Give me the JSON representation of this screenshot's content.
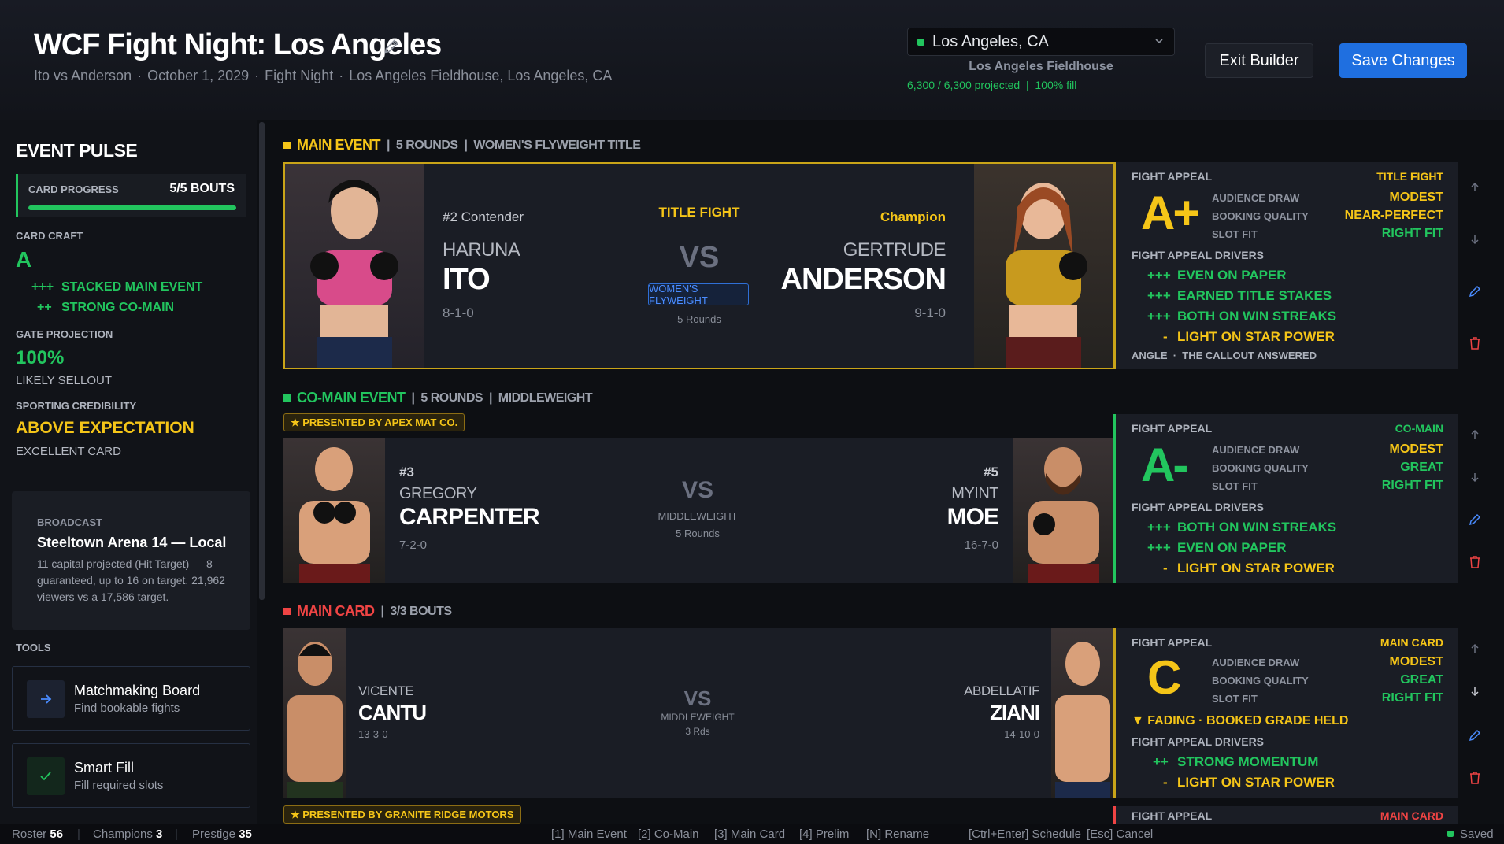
{
  "header": {
    "title": "WCF Fight Night: Los Angeles",
    "sub_matchup": "Ito vs Anderson",
    "sub_date": "October 1, 2029",
    "sub_type": "Fight Night",
    "sub_venue": "Los Angeles Fieldhouse, Los Angeles, CA",
    "location": "Los Angeles, CA",
    "venue": "Los Angeles Fieldhouse",
    "fill": "6,300 / 6,300 projected  |  100% fill",
    "exit_label": "Exit Builder",
    "save_label": "Save Changes"
  },
  "sidebar": {
    "title": "EVENT PULSE",
    "progress_label": "CARD PROGRESS",
    "progress_value": "5/5 BOUTS",
    "progress_fraction": 1.0,
    "craft_label": "CARD CRAFT",
    "craft_grade": "A",
    "craft_drivers": [
      {
        "mark": "+++",
        "text": "STACKED MAIN EVENT"
      },
      {
        "mark": "++",
        "text": "STRONG CO-MAIN"
      }
    ],
    "gate_label": "GATE PROJECTION",
    "gate_value": "100%",
    "gate_note": "LIKELY SELLOUT",
    "cred_label": "SPORTING CREDIBILITY",
    "cred_value": "ABOVE EXPECTATION",
    "cred_note": "EXCELLENT CARD",
    "broadcast_label": "BROADCAST",
    "broadcast_name": "Steeltown Arena 14 — Local",
    "broadcast_desc": "11 capital projected (Hit Target) — 8 guaranteed, up to 16 on target. 21,962 viewers vs a 17,586 target.",
    "tools_label": "TOOLS",
    "tools": [
      {
        "title": "Matchmaking Board",
        "desc": "Find bookable fights"
      },
      {
        "title": "Smart Fill",
        "desc": "Fill required slots"
      }
    ]
  },
  "main_event": {
    "label": "MAIN EVENT",
    "meta": "|  5 ROUNDS  |  WOMEN'S FLYWEIGHT TITLE",
    "left": {
      "rank": "#2 Contender",
      "first": "HARUNA",
      "last": "ITO",
      "record": "8-1-0"
    },
    "right": {
      "rank": "Champion",
      "first": "GERTRUDE",
      "last": "ANDERSON",
      "record": "9-1-0"
    },
    "badge": "TITLE FIGHT",
    "vs": "VS",
    "weight": "WOMEN'S FLYWEIGHT",
    "rounds": "5 Rounds",
    "appeal": {
      "head": "FIGHT APPEAL",
      "tag": "TITLE FIGHT",
      "grade": "A+",
      "rows": [
        {
          "k": "AUDIENCE DRAW",
          "v": "MODEST"
        },
        {
          "k": "BOOKING QUALITY",
          "v": "NEAR-PERFECT"
        },
        {
          "k": "SLOT FIT",
          "v": "RIGHT FIT"
        }
      ],
      "drivers_head": "FIGHT APPEAL DRIVERS",
      "drivers": [
        {
          "mark": "+++",
          "text": "EVEN ON PAPER"
        },
        {
          "mark": "+++",
          "text": "EARNED TITLE STAKES"
        },
        {
          "mark": "+++",
          "text": "BOTH ON WIN STREAKS"
        },
        {
          "mark": "-",
          "text": "LIGHT ON STAR POWER"
        }
      ],
      "angle": "ANGLE  ·  THE CALLOUT ANSWERED"
    }
  },
  "co_main": {
    "label": "CO-MAIN EVENT",
    "meta": "|  5 ROUNDS  |  MIDDLEWEIGHT",
    "sponsor": "★ PRESENTED BY APEX MAT CO.",
    "left": {
      "rank": "#3",
      "first": "GREGORY",
      "last": "CARPENTER",
      "record": "7-2-0"
    },
    "right": {
      "rank": "#5",
      "first": "MYINT",
      "last": "MOE",
      "record": "16-7-0"
    },
    "vs": "VS",
    "weight": "MIDDLEWEIGHT",
    "rounds": "5 Rounds",
    "appeal": {
      "head": "FIGHT APPEAL",
      "tag": "CO-MAIN",
      "grade": "A-",
      "rows": [
        {
          "k": "AUDIENCE DRAW",
          "v": "MODEST"
        },
        {
          "k": "BOOKING QUALITY",
          "v": "GREAT"
        },
        {
          "k": "SLOT FIT",
          "v": "RIGHT FIT"
        }
      ],
      "drivers_head": "FIGHT APPEAL DRIVERS",
      "drivers": [
        {
          "mark": "+++",
          "text": "BOTH ON WIN STREAKS"
        },
        {
          "mark": "+++",
          "text": "EVEN ON PAPER"
        },
        {
          "mark": "-",
          "text": "LIGHT ON STAR POWER"
        }
      ]
    }
  },
  "main_card": {
    "label": "MAIN CARD",
    "meta": "|  3/3 BOUTS",
    "sponsor": "★ PRESENTED BY GRANITE RIDGE MOTORS",
    "left": {
      "first": "VICENTE",
      "last": "CANTU",
      "record": "13-3-0"
    },
    "right": {
      "first": "ABDELLATIF",
      "last": "ZIANI",
      "record": "14-10-0"
    },
    "vs": "VS",
    "weight": "MIDDLEWEIGHT",
    "rounds": "3 Rds",
    "appeal": {
      "head": "FIGHT APPEAL",
      "tag": "MAIN CARD",
      "grade": "C",
      "rows": [
        {
          "k": "AUDIENCE DRAW",
          "v": "MODEST"
        },
        {
          "k": "BOOKING QUALITY",
          "v": "GREAT"
        },
        {
          "k": "SLOT FIT",
          "v": "RIGHT FIT"
        }
      ],
      "fading": "▼ FADING · BOOKED GRADE HELD",
      "drivers_head": "FIGHT APPEAL DRIVERS",
      "drivers": [
        {
          "mark": "++",
          "text": "STRONG MOMENTUM"
        },
        {
          "mark": "-",
          "text": "LIGHT ON STAR POWER"
        }
      ]
    },
    "next_head": "FIGHT APPEAL",
    "next_tag": "MAIN CARD"
  },
  "footer": {
    "roster_label": "Roster",
    "roster": "56",
    "champs_label": "Champions",
    "champs": "3",
    "prestige_label": "Prestige",
    "prestige": "35",
    "keys": [
      "[1] Main Event",
      "[2] Co-Main",
      "[3] Main Card",
      "[4] Prelim",
      "[N] Rename",
      "[Ctrl+Enter] Schedule",
      "[Esc] Cancel"
    ],
    "saved": "Saved"
  },
  "colors": {
    "green": "#22c55e",
    "gold": "#f5c518",
    "red": "#ef4444",
    "blue": "#1f6fe0"
  }
}
